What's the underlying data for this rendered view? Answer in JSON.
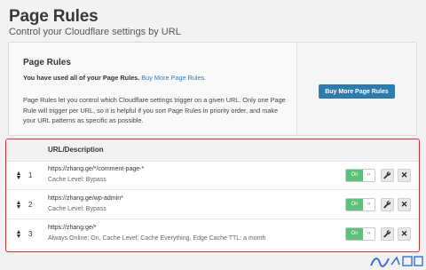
{
  "header": {
    "title": "Page Rules",
    "subtitle": "Control your Cloudflare settings by URL"
  },
  "usage_card": {
    "heading": "Page Rules",
    "notice_bold": "You have used all of your Page Rules.",
    "notice_link": "Buy More Page Rules.",
    "description": "Page Rules let you control which Cloudflare settings trigger on a given URL. Only one Page Rule will trigger per URL, so it is helpful if you sort Page Rules in priority order, and make your URL patterns as specific as possible.",
    "buy_button_label": "Buy More Page Rules"
  },
  "rules_table": {
    "column_header": "URL/Description",
    "rows": [
      {
        "number": "1",
        "url": "https://zhang.ge/*/comment-page-*",
        "settings": "Cache Level: Bypass",
        "toggle_label": "On",
        "enabled": true
      },
      {
        "number": "2",
        "url": "https://zhang.ge/wp-admin*",
        "settings": "Cache Level: Bypass",
        "toggle_label": "On",
        "enabled": true
      },
      {
        "number": "3",
        "url": "https://zhang.ge/*",
        "settings": "Always Online: On, Cache Level: Cache Everything, Edge Cache TTL: a month",
        "toggle_label": "On",
        "enabled": true
      }
    ]
  },
  "colors": {
    "accent_button": "#2c7cb0",
    "toggle_on": "#5cc17b",
    "link": "#2f7bbf",
    "highlight_border": "#d33030"
  },
  "icons": {
    "drag": "drag-handle-icon",
    "toggle_knob": "toggle-knob-icon",
    "edit": "wrench-icon",
    "delete": "close-icon"
  }
}
